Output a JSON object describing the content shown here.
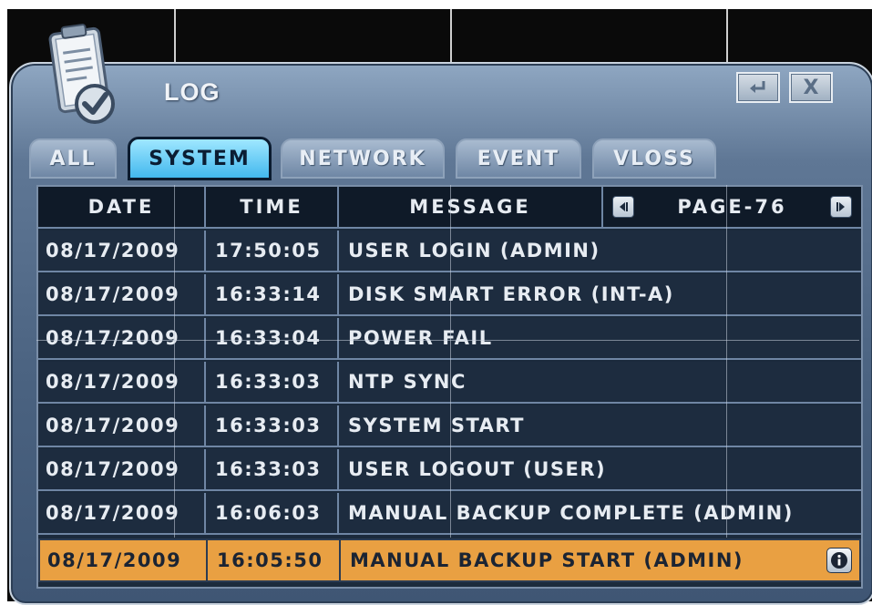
{
  "dialog": {
    "title": "LOG",
    "enter_icon": "enter-return-icon",
    "close_label": "X",
    "title_icon": "clipboard-check-icon"
  },
  "tabs": [
    {
      "label": "ALL",
      "active": false
    },
    {
      "label": "SYSTEM",
      "active": true
    },
    {
      "label": "NETWORK",
      "active": false
    },
    {
      "label": "EVENT",
      "active": false
    },
    {
      "label": "VLOSS",
      "active": false
    }
  ],
  "table": {
    "headers": {
      "date": "DATE",
      "time": "TIME",
      "message": "MESSAGE"
    },
    "pager": {
      "label": "PAGE-76",
      "prev_icon": "prev-page-icon",
      "next_icon": "next-page-icon"
    },
    "rows": [
      {
        "date": "08/17/2009",
        "time": "17:50:05",
        "message": "USER LOGIN (ADMIN)"
      },
      {
        "date": "08/17/2009",
        "time": "16:33:14",
        "message": "DISK SMART ERROR (INT-A)"
      },
      {
        "date": "08/17/2009",
        "time": "16:33:04",
        "message": "POWER FAIL"
      },
      {
        "date": "08/17/2009",
        "time": "16:33:03",
        "message": "NTP SYNC"
      },
      {
        "date": "08/17/2009",
        "time": "16:33:03",
        "message": "SYSTEM START"
      },
      {
        "date": "08/17/2009",
        "time": "16:33:03",
        "message": "USER LOGOUT (USER)"
      },
      {
        "date": "08/17/2009",
        "time": "16:06:03",
        "message": "MANUAL BACKUP COMPLETE (ADMIN)"
      },
      {
        "date": "08/17/2009",
        "time": "16:05:50",
        "message": "MANUAL BACKUP START (ADMIN)",
        "selected": true
      }
    ]
  },
  "colors": {
    "selected_row": "#e9a042",
    "active_tab": "#43b8ee",
    "table_bg": "#1d2c3f"
  }
}
